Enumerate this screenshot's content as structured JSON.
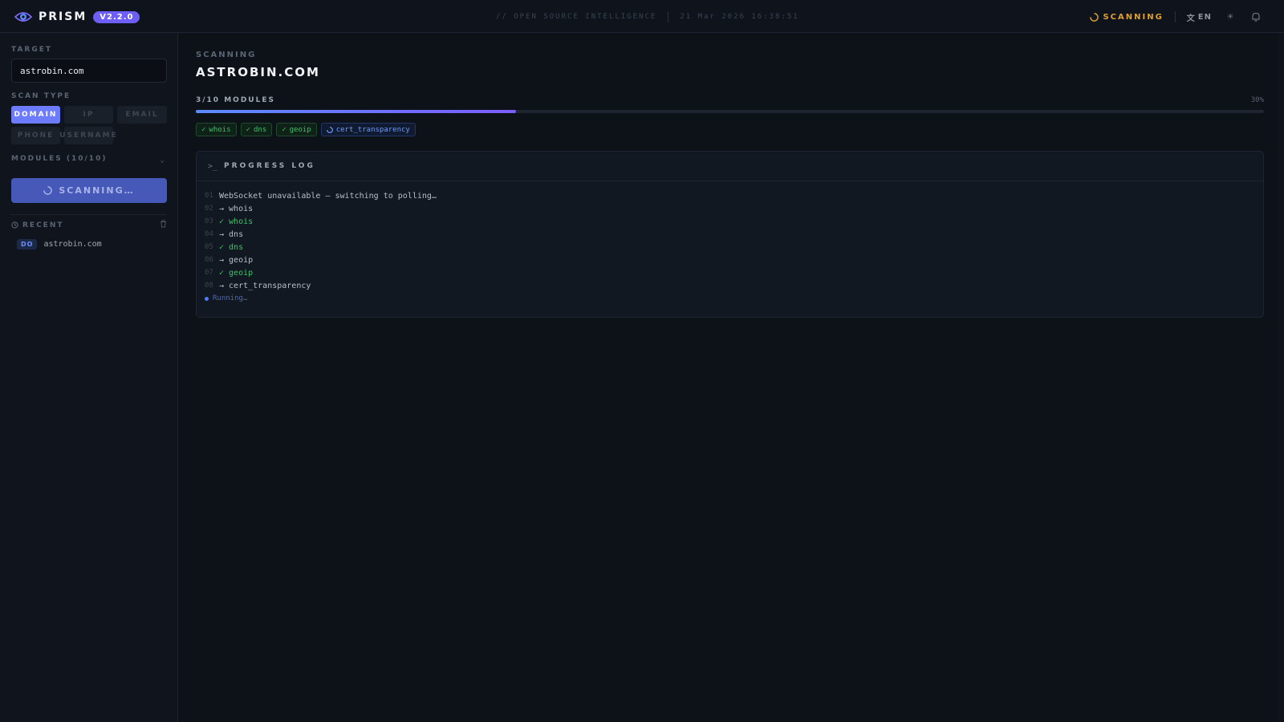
{
  "app": {
    "name": "PRISM",
    "version": "V2.2.0",
    "tagline": "// OPEN SOURCE INTELLIGENCE",
    "datetime": "21 Mar 2026 16:38:51",
    "status": "SCANNING",
    "language": "EN"
  },
  "sidebar": {
    "target_label": "TARGET",
    "target_value": "astrobin.com",
    "scan_type_label": "SCAN TYPE",
    "scan_types": [
      "DOMAIN",
      "IP",
      "EMAIL",
      "PHONE",
      "USERNAME"
    ],
    "active_scan_type": "DOMAIN",
    "modules_label": "MODULES (10/10)",
    "scan_button": "SCANNING…",
    "recent_label": "RECENT",
    "recent_items": [
      {
        "badge": "DO",
        "text": "astrobin.com"
      }
    ]
  },
  "main": {
    "status_label": "SCANNING",
    "target_title": "ASTROBIN.COM",
    "modules_progress": "3/10 MODULES",
    "percent_text": "30%",
    "progress_fraction": 0.3,
    "chips": [
      {
        "label": "whois",
        "state": "done"
      },
      {
        "label": "dns",
        "state": "done"
      },
      {
        "label": "geoip",
        "state": "done"
      },
      {
        "label": "cert_transparency",
        "state": "running"
      }
    ],
    "log_title": "PROGRESS LOG",
    "log": [
      {
        "num": "01",
        "text": "WebSocket unavailable — switching to polling…",
        "ok": false
      },
      {
        "num": "02",
        "text": "→ whois",
        "ok": false
      },
      {
        "num": "03",
        "text": "✓ whois",
        "ok": true
      },
      {
        "num": "04",
        "text": "→ dns",
        "ok": false
      },
      {
        "num": "05",
        "text": "✓ dns",
        "ok": true
      },
      {
        "num": "06",
        "text": "→ geoip",
        "ok": false
      },
      {
        "num": "07",
        "text": "✓ geoip",
        "ok": true
      },
      {
        "num": "08",
        "text": "→ cert_transparency",
        "ok": false
      }
    ],
    "running_text": "Running…"
  },
  "colors": {
    "accent": "#6d7bff",
    "badge": "#6d5ef5",
    "success": "#3fbf6a",
    "warning": "#e0a030"
  },
  "icons": {
    "logo": "eye-logo-icon",
    "status": "spinner-icon",
    "language": "translate-icon",
    "theme": "sun-icon",
    "notifications": "bell-icon",
    "log": "terminal-icon",
    "recent": "clock-icon",
    "clear": "trash-icon"
  }
}
